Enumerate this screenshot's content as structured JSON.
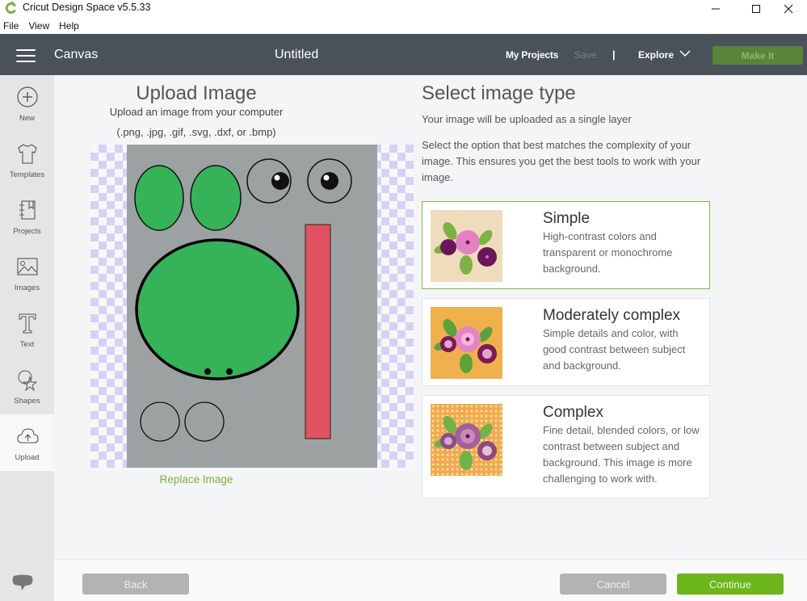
{
  "window": {
    "app_title": "Cricut Design Space  v5.5.33",
    "controls": [
      "minimize",
      "maximize",
      "close"
    ]
  },
  "menubar": {
    "items": [
      "File",
      "View",
      "Help"
    ]
  },
  "header": {
    "section": "Canvas",
    "project_title": "Untitled",
    "my_projects": "My Projects",
    "save": "Save",
    "separator": "|",
    "explore": "Explore",
    "make_it": "Make It"
  },
  "sidebar": {
    "items": [
      {
        "label": "New",
        "icon": "plus-circle-icon"
      },
      {
        "label": "Templates",
        "icon": "tshirt-icon"
      },
      {
        "label": "Projects",
        "icon": "notebook-icon"
      },
      {
        "label": "Images",
        "icon": "image-icon"
      },
      {
        "label": "Text",
        "icon": "text-icon"
      },
      {
        "label": "Shapes",
        "icon": "shapes-icon"
      },
      {
        "label": "Upload",
        "icon": "cloud-upload-icon",
        "active": true
      }
    ]
  },
  "upload": {
    "title": "Upload Image",
    "subtitle": "Upload an image from your computer",
    "formats": "(.png, .jpg, .gif, .svg, .dxf, or .bmp)",
    "replace_link": "Replace Image"
  },
  "select": {
    "title": "Select image type",
    "subtitle": "Your image will be uploaded as a single layer",
    "description": "Select the option that best matches the complexity of your image. This ensures you get the best tools to work with your image.",
    "options": [
      {
        "title": "Simple",
        "description": "High-contrast colors and transparent or monochrome background.",
        "selected": true
      },
      {
        "title": "Moderately complex",
        "description": "Simple details and color, with good contrast between subject and background.",
        "selected": false
      },
      {
        "title": "Complex",
        "description": "Fine detail, blended colors, or low contrast between subject and background. This image is more challenging to work with.",
        "selected": false
      }
    ]
  },
  "footer": {
    "back": "Back",
    "cancel": "Cancel",
    "continue": "Continue"
  },
  "colors": {
    "accent_green": "#6cb51b",
    "header_bg": "#4a5159",
    "selected_border": "#84b346"
  }
}
